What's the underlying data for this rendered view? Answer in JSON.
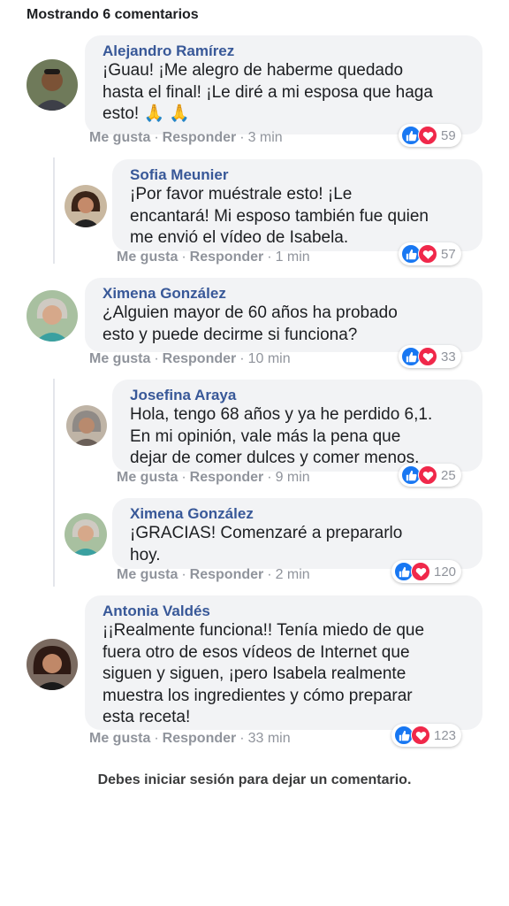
{
  "header": {
    "count_label": "Mostrando 6 comentarios"
  },
  "labels": {
    "like": "Me gusta",
    "reply": "Responder",
    "sep": "·"
  },
  "comments": [
    {
      "author": "Alejandro Ramírez",
      "lines": [
        "¡Guau! ¡Me alegro de haberme quedado",
        "hasta el final! ¡Le diré a mi esposa que haga",
        "esto! 🙏 🙏"
      ],
      "time": "3 min",
      "reactions": "59",
      "avatar_color": "#6b4a32"
    },
    {
      "author": "Sofia Meunier",
      "lines": [
        "¡Por favor muéstrale esto! ¡Le",
        "encantará! Mi esposo también fue quien",
        "me envió el vídeo de Isabela."
      ],
      "time": "1 min",
      "reactions": "57",
      "avatar_color": "#5a3a2a"
    },
    {
      "author": "Ximena González",
      "lines": [
        "¿Alguien mayor de 60 años ha probado",
        "esto y puede decirme si funciona?"
      ],
      "time": "10 min",
      "reactions": "33",
      "avatar_color": "#9a8a7a"
    },
    {
      "author": "Josefina Araya",
      "lines": [
        "Hola, tengo 68 años y ya he perdido 6,1.",
        "En mi opinión, vale más la pena que",
        "dejar de comer dulces y comer menos."
      ],
      "time": "9 min",
      "reactions": "25",
      "avatar_color": "#8a7a6a"
    },
    {
      "author": "Ximena González",
      "lines": [
        "¡GRACIAS! Comenzaré a prepararlo",
        "hoy."
      ],
      "time": "2 min",
      "reactions": "120",
      "avatar_color": "#9a8a7a"
    },
    {
      "author": "Antonia Valdés",
      "lines": [
        "¡¡Realmente funciona!! Tenía miedo de que",
        "fuera otro de esos vídeos de Internet que",
        "siguen y siguen, ¡pero Isabela realmente",
        "muestra los ingredientes y cómo preparar",
        "esta receta!"
      ],
      "time": "33 min",
      "reactions": "123",
      "avatar_color": "#4a2a20"
    }
  ],
  "footer": {
    "text": "Debes iniciar sesión para dejar un comentario."
  },
  "colors": {
    "author": "#385898",
    "like": "#1877f2",
    "love": "#f0284a",
    "bubble": "#f2f3f5"
  }
}
